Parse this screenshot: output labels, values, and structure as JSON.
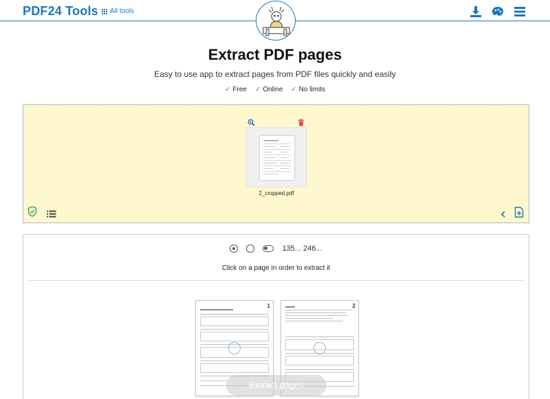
{
  "header": {
    "brand": "PDF24 Tools",
    "all_tools": "All tools",
    "icons": [
      "download-icon",
      "palette-icon",
      "menu-icon"
    ]
  },
  "main": {
    "title": "Extract PDF pages",
    "subtitle": "Easy to use app to extract pages from PDF files quickly and easily",
    "features": [
      {
        "check": "✓",
        "label": "Free"
      },
      {
        "check": "✓",
        "label": "Online"
      },
      {
        "check": "✓",
        "label": "No limits"
      }
    ]
  },
  "dropzone": {
    "file_name": "2_cropped.pdf"
  },
  "extract": {
    "mode_label": "135... 246...",
    "instruction": "Click on a page in order to extract it",
    "pages": [
      {
        "number": "1"
      },
      {
        "number": "2"
      }
    ],
    "button_label": "Extract pages"
  },
  "colors": {
    "brand": "#1b75bb",
    "dropzone_bg": "#fff8cf",
    "check": "#2aa84a",
    "trash": "#d9534f"
  }
}
